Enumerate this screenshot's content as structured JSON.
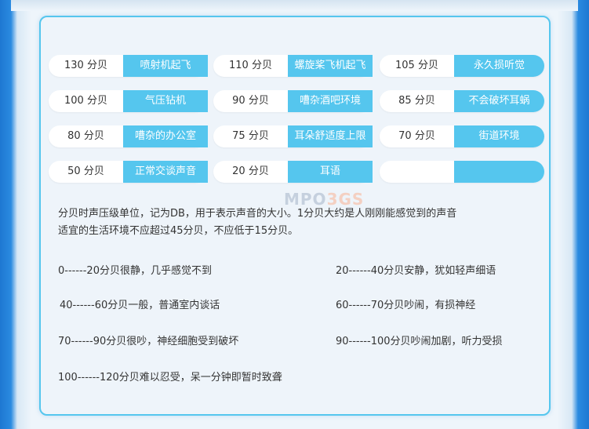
{
  "rows": [
    [
      {
        "num": "130 分贝",
        "label": "喷射机起飞"
      },
      {
        "num": "110 分贝",
        "label": "螺旋桨飞机起飞"
      },
      {
        "num": "105 分贝",
        "label": "永久损听觉"
      }
    ],
    [
      {
        "num": "100 分贝",
        "label": "气压钻机"
      },
      {
        "num": "90  分贝",
        "label": "嘈杂酒吧环境"
      },
      {
        "num": "85  分贝",
        "label": "不会破坏耳蜗"
      }
    ],
    [
      {
        "num": "80  分贝",
        "label": "嘈杂的办公室"
      },
      {
        "num": "75  分贝",
        "label": "耳朵舒适度上限"
      },
      {
        "num": "70  分贝",
        "label": "街道环境"
      }
    ],
    [
      {
        "num": "50  分贝",
        "label": "正常交谈声音"
      },
      {
        "num": "20  分贝",
        "label": "耳语"
      },
      {
        "num": "",
        "label": ""
      }
    ]
  ],
  "description": {
    "line1": "分贝时声压级单位，记为DB，用于表示声音的大小。1分贝大约是人刚刚能感觉到的声音",
    "line2": "适宜的生活环境不应超过45分贝，不应低于15分贝。"
  },
  "scale": [
    "0------20分贝很静，几乎感觉不到",
    "20------40分贝安静，犹如轻声细语",
    "40------60分贝一般，普通室内谈话",
    "60------70分贝吵闹，有损神经",
    "70------90分贝很吵，神经细胞受到破坏",
    "90------100分贝吵闹加剧，听力受损",
    "100------120分贝难以忍受，呆一分钟即暂时致聋"
  ],
  "watermark": {
    "main": "MPO",
    "accent": "3GS"
  },
  "colors": {
    "accent": "#55c6ee",
    "frame": "#1e78d2"
  }
}
